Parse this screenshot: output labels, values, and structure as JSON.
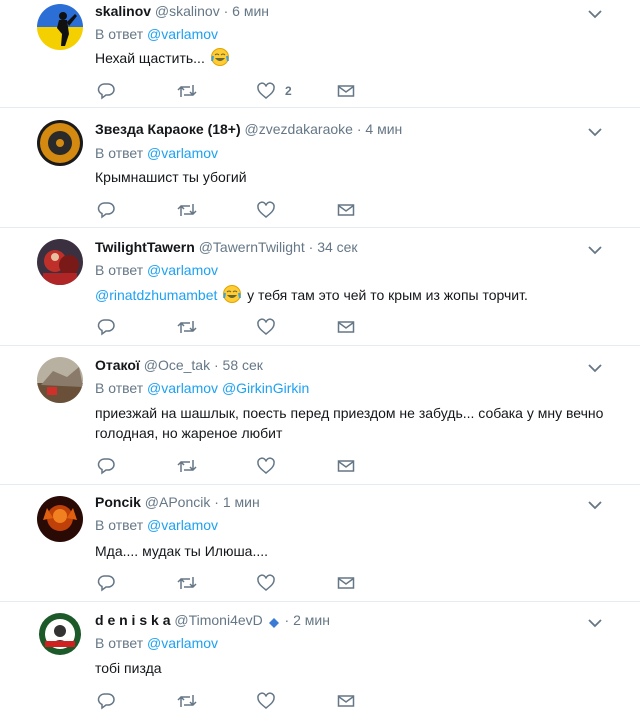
{
  "common": {
    "reply_prefix": "В ответ",
    "reply_mention": "@varlamov"
  },
  "tweets": [
    {
      "name": "skalinov",
      "handle": "@skalinov",
      "time": "6 мин",
      "text": "Нехай щастить...",
      "emoji": "face-with-tears-of-joy",
      "like_count": "2"
    },
    {
      "name": "Звезда Караоке (18+)",
      "handle": "@zvezdakaraoke",
      "time": "4 мин",
      "text": "Крымнашист ты убогий"
    },
    {
      "name": "TwilightTawern",
      "handle": "@TawernTwilight",
      "time": "34 сек",
      "mention": "@rinatdzhumambet",
      "emoji": "face-with-tears-of-joy",
      "text": "у тебя там это чей то крым из жопы торчит."
    },
    {
      "name": "Отакої",
      "handle": "@Oce_tak",
      "time": "58 сек",
      "reply_extra": "@GirkinGirkin",
      "text_line1": "приезжай на шашлык, поесть перед приездом не забудь... собака у мну вечно",
      "text_line2": "голодная, но жареное любит"
    },
    {
      "name": "Poncik",
      "handle": "@APoncik",
      "time": "1 мин",
      "text": "Мда.... мудак ты Илюша...."
    },
    {
      "name": "d e n i s k a",
      "handle": "@Timoni4evD",
      "time": "2 мин",
      "handle_badge": "verified-like-icon",
      "text": "тобі пизда"
    }
  ],
  "colors": {
    "link": "#1da1f2",
    "muted": "#657786",
    "divider": "#e6ecf0",
    "text": "#14171a"
  }
}
